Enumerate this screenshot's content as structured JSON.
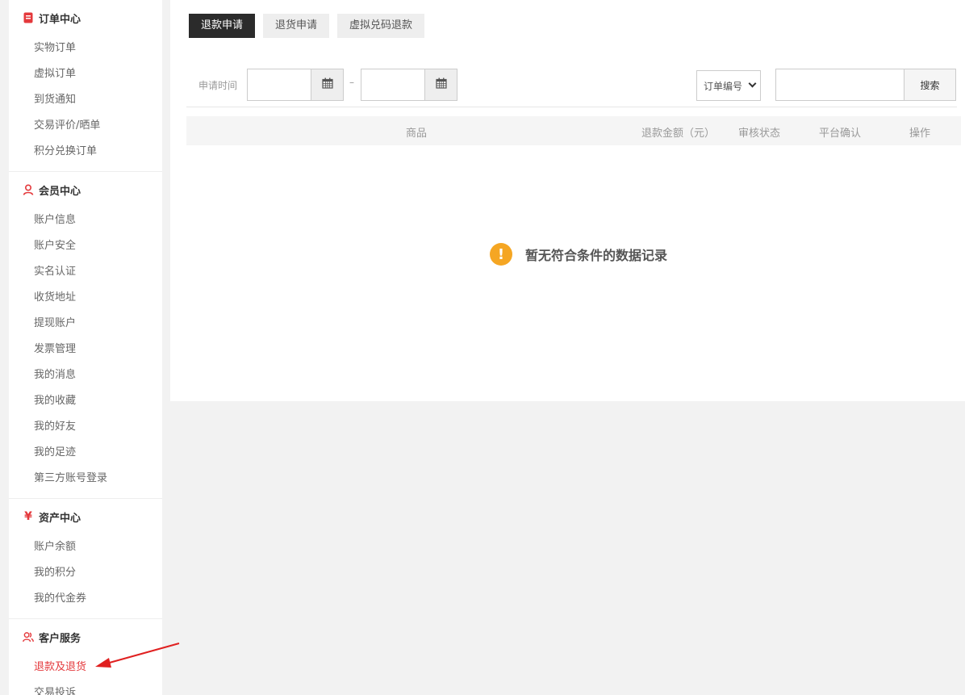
{
  "sidebar": {
    "groups": [
      {
        "title": "订单中心",
        "icon": "order-doc-icon",
        "items": [
          "实物订单",
          "虚拟订单",
          "到货通知",
          "交易评价/晒单",
          "积分兑换订单"
        ]
      },
      {
        "title": "会员中心",
        "icon": "user-icon",
        "items": [
          "账户信息",
          "账户安全",
          "实名认证",
          "收货地址",
          "提现账户",
          "发票管理",
          "我的消息",
          "我的收藏",
          "我的好友",
          "我的足迹",
          "第三方账号登录"
        ]
      },
      {
        "title": "资产中心",
        "icon": "yen-icon",
        "items": [
          "账户余额",
          "我的积分",
          "我的代金券"
        ]
      },
      {
        "title": "客户服务",
        "icon": "service-users-icon",
        "items": [
          "退款及退货",
          "交易投诉"
        ]
      }
    ],
    "active_item": "退款及退货"
  },
  "tabs": [
    "退款申请",
    "退货申请",
    "虚拟兑码退款"
  ],
  "active_tab": "退款申请",
  "filter": {
    "date_label": "申请时间",
    "date_separator": "–",
    "start_date": "",
    "end_date": "",
    "search_type": "订单编号",
    "search_value": "",
    "search_button": "搜索"
  },
  "table": {
    "columns": [
      "商品",
      "退款金额（元）",
      "审核状态",
      "平台确认",
      "操作"
    ]
  },
  "empty_message": "暂无符合条件的数据记录",
  "colors": {
    "accent": "#e4393c",
    "active_tab_bg": "#2b2b2b",
    "warning": "#f5a623",
    "annotation_arrow": "#e02020"
  }
}
